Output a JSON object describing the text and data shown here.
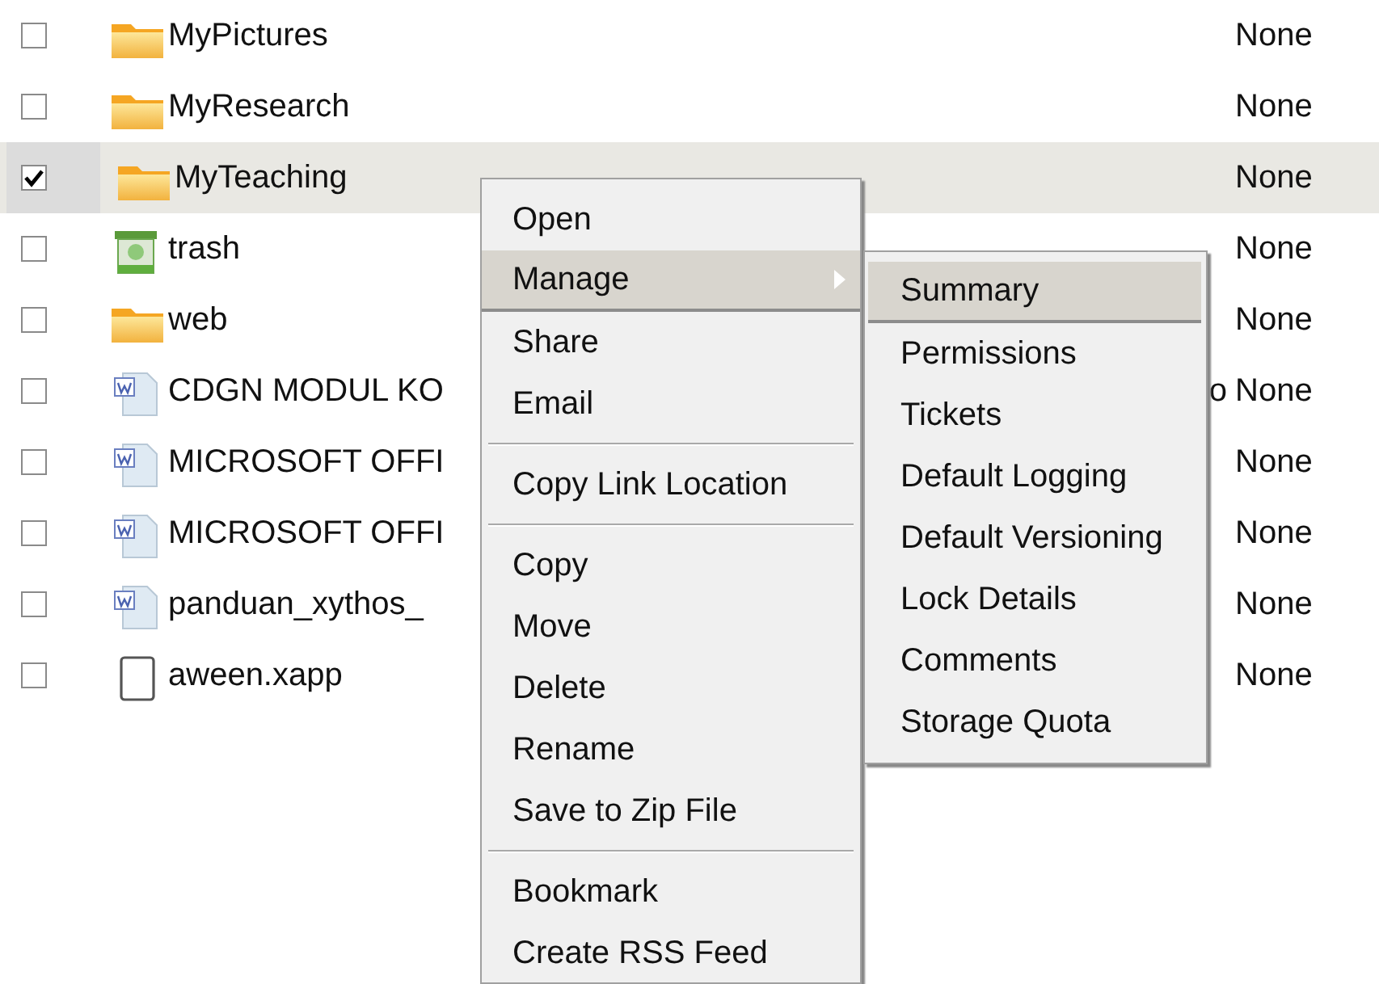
{
  "files": [
    {
      "kind": "folder",
      "name": "MyPictures",
      "checked": false,
      "selected": false,
      "status": "None"
    },
    {
      "kind": "folder",
      "name": "MyResearch",
      "checked": false,
      "selected": false,
      "status": "None"
    },
    {
      "kind": "folder",
      "name": "MyTeaching",
      "checked": true,
      "selected": true,
      "status": "None"
    },
    {
      "kind": "trash",
      "name": "trash",
      "checked": false,
      "selected": false,
      "status": "None"
    },
    {
      "kind": "folder",
      "name": "web",
      "checked": false,
      "selected": false,
      "status": "None"
    },
    {
      "kind": "document",
      "name": "CDGN MODUL KO",
      "name_tail": "o",
      "checked": false,
      "selected": false,
      "status": "None"
    },
    {
      "kind": "document",
      "name": "MICROSOFT OFFI",
      "checked": false,
      "selected": false,
      "status": "None"
    },
    {
      "kind": "document",
      "name": "MICROSOFT OFFI",
      "checked": false,
      "selected": false,
      "status": "None"
    },
    {
      "kind": "document",
      "name": "panduan_xythos_",
      "checked": false,
      "selected": false,
      "status": "None"
    },
    {
      "kind": "file",
      "name": "aween.xapp",
      "checked": false,
      "selected": false,
      "status": "None"
    }
  ],
  "context_menu": {
    "items": [
      {
        "kind": "item",
        "label": "Open",
        "selected": false,
        "submenu": false
      },
      {
        "kind": "item",
        "label": "Manage",
        "selected": true,
        "submenu": true
      },
      {
        "kind": "item",
        "label": "Share",
        "selected": false,
        "submenu": false
      },
      {
        "kind": "item",
        "label": "Email",
        "selected": false,
        "submenu": false
      },
      {
        "kind": "separator"
      },
      {
        "kind": "item",
        "label": "Copy Link Location",
        "selected": false,
        "submenu": false
      },
      {
        "kind": "separator"
      },
      {
        "kind": "item",
        "label": "Copy",
        "selected": false,
        "submenu": false
      },
      {
        "kind": "item",
        "label": "Move",
        "selected": false,
        "submenu": false
      },
      {
        "kind": "item",
        "label": "Delete",
        "selected": false,
        "submenu": false
      },
      {
        "kind": "item",
        "label": "Rename",
        "selected": false,
        "submenu": false
      },
      {
        "kind": "item",
        "label": "Save to Zip File",
        "selected": false,
        "submenu": false
      },
      {
        "kind": "separator"
      },
      {
        "kind": "item",
        "label": "Bookmark",
        "selected": false,
        "submenu": false
      },
      {
        "kind": "item",
        "label": "Create RSS Feed",
        "selected": false,
        "submenu": false
      }
    ]
  },
  "submenu": {
    "items": [
      {
        "label": "Summary",
        "selected": true
      },
      {
        "label": "Permissions",
        "selected": false
      },
      {
        "label": "Tickets",
        "selected": false
      },
      {
        "label": "Default Logging",
        "selected": false
      },
      {
        "label": "Default Versioning",
        "selected": false
      },
      {
        "label": "Lock Details",
        "selected": false
      },
      {
        "label": "Comments",
        "selected": false
      },
      {
        "label": "Storage Quota",
        "selected": false
      }
    ]
  }
}
